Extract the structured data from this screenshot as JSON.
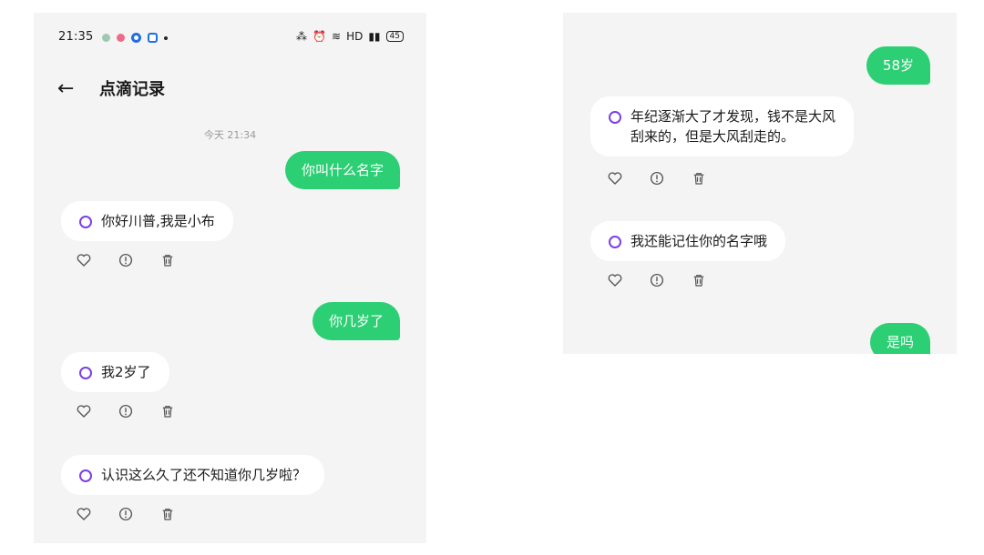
{
  "left": {
    "status": {
      "time": "21:35",
      "hd": "HD",
      "battery": "45"
    },
    "header": {
      "back_icon": "arrow-left-icon",
      "title": "点滴记录"
    },
    "timestamp": "今天 21:34",
    "messages": [
      {
        "role": "user",
        "text": "你叫什么名字"
      },
      {
        "role": "bot",
        "text": "你好川普,我是小布"
      },
      {
        "role": "user",
        "text": "你几岁了"
      },
      {
        "role": "bot",
        "text": "我2岁了"
      },
      {
        "role": "bot",
        "text": "认识这么久了还不知道你几岁啦？"
      }
    ]
  },
  "right": {
    "messages": [
      {
        "role": "user",
        "text": "58岁"
      },
      {
        "role": "bot",
        "text": "年纪逐渐大了才发现，钱不是大风\n刮来的，但是大风刮走的。"
      },
      {
        "role": "bot",
        "text": "我还能记住你的名字哦"
      },
      {
        "role": "user",
        "text": "是吗"
      }
    ]
  },
  "colors": {
    "user_bubble": "#2ccf73",
    "bot_logo": "#7b3fe4",
    "background": "#f4f4f4"
  },
  "icons": [
    "heart-icon",
    "info-icon",
    "trash-icon"
  ]
}
